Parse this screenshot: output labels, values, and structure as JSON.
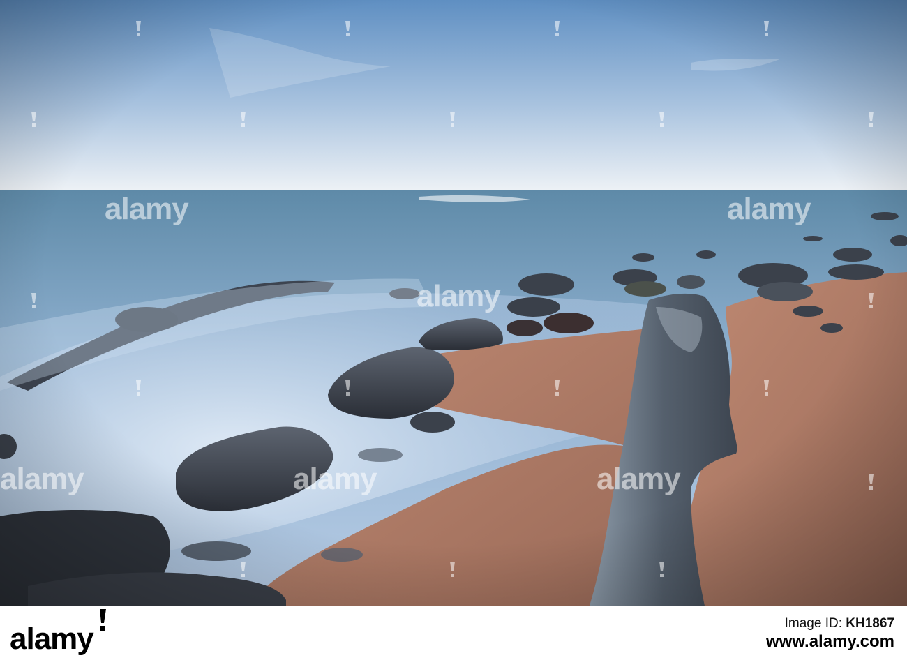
{
  "photo": {
    "subject": "long-exposure-seascape",
    "colors": {
      "sky_top": "#6f9bc9",
      "sky_horizon": "#eef2f6",
      "sea": "#6e90b0",
      "mist": "#c9d9ec",
      "sand": "#b97f6a",
      "rock": "#3f4550"
    },
    "watermark": {
      "text": "alamy",
      "count": 6
    }
  },
  "footer": {
    "brand": "alamy",
    "image_id_label": "Image ID:",
    "image_id": "KH1867",
    "site": "www.alamy.com"
  }
}
